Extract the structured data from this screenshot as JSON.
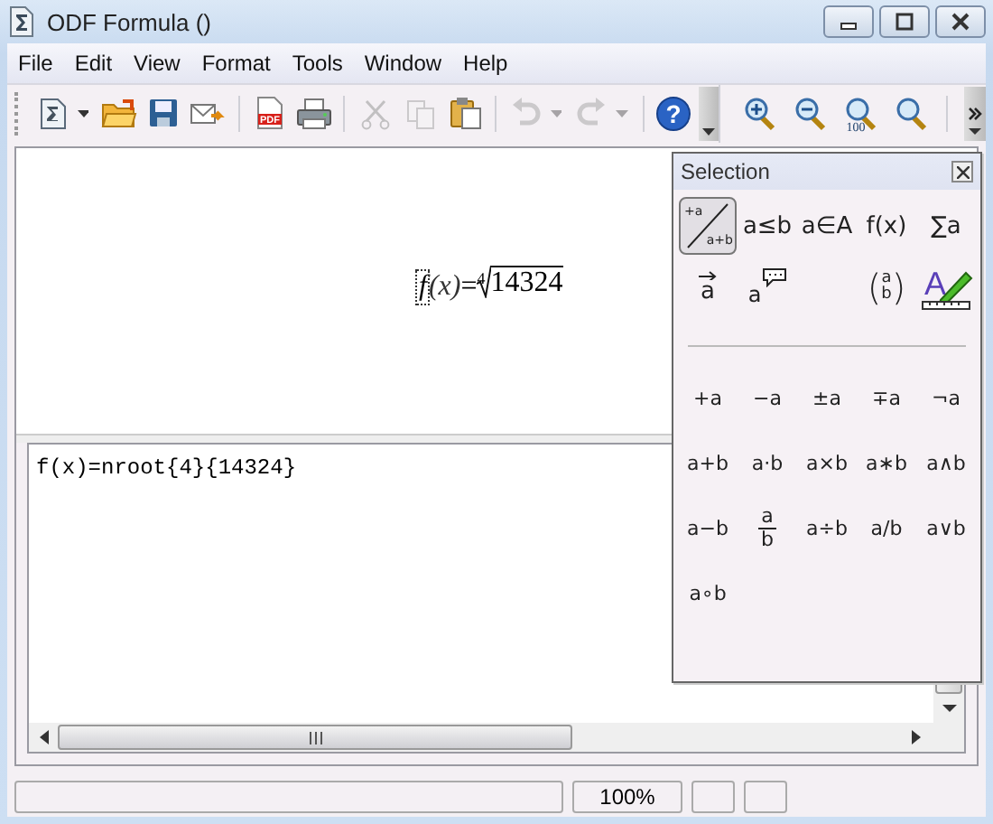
{
  "window": {
    "title": "ODF Formula ()"
  },
  "menu": [
    {
      "label": "File"
    },
    {
      "label": "Edit"
    },
    {
      "label": "View"
    },
    {
      "label": "Format"
    },
    {
      "label": "Tools"
    },
    {
      "label": "Window"
    },
    {
      "label": "Help"
    }
  ],
  "toolbar": [
    {
      "kind": "new",
      "disabled": false,
      "dropdown": true
    },
    {
      "kind": "open",
      "disabled": false
    },
    {
      "kind": "save",
      "disabled": false
    },
    {
      "kind": "mail",
      "disabled": false
    },
    {
      "kind": "sep"
    },
    {
      "kind": "pdf",
      "disabled": false,
      "text": "PDF"
    },
    {
      "kind": "print",
      "disabled": false
    },
    {
      "kind": "sep"
    },
    {
      "kind": "cut",
      "disabled": true
    },
    {
      "kind": "copy",
      "disabled": true
    },
    {
      "kind": "paste",
      "disabled": false
    },
    {
      "kind": "sep"
    },
    {
      "kind": "undo",
      "disabled": true,
      "dropdown": true
    },
    {
      "kind": "redo",
      "disabled": true,
      "dropdown": true
    },
    {
      "kind": "sep"
    },
    {
      "kind": "help",
      "disabled": false,
      "text": "?"
    }
  ],
  "zoom_toolbar": [
    {
      "kind": "zoom-in",
      "disabled": false
    },
    {
      "kind": "zoom-out",
      "disabled": false
    },
    {
      "kind": "zoom-100",
      "disabled": false,
      "text": "100"
    },
    {
      "kind": "zoom-all",
      "disabled": false
    },
    {
      "kind": "sep"
    }
  ],
  "formula": {
    "function": "f",
    "argument": "(x)",
    "equals": "=",
    "index": "4",
    "radicand": "14324"
  },
  "editor": {
    "value": "f(x)=nroot{4}{14324}"
  },
  "selection": {
    "title": "Selection",
    "categories": [
      {
        "kind": "fraction",
        "top": "+a",
        "bottom": "a+b",
        "selected": true
      },
      {
        "kind": "text",
        "label": "a≤b",
        "selected": false
      },
      {
        "kind": "text",
        "label": "a∈A",
        "selected": false
      },
      {
        "kind": "text",
        "label": "f(x)",
        "selected": false
      },
      {
        "kind": "text",
        "label": "∑a",
        "selected": false
      },
      {
        "kind": "vector",
        "label": "a",
        "selected": false
      },
      {
        "kind": "attribute",
        "label": "a",
        "selected": false
      },
      {
        "kind": "empty"
      },
      {
        "kind": "binom",
        "left": "(",
        "top": "a",
        "bottom": "b",
        "right": ")",
        "selected": false
      },
      {
        "kind": "format",
        "label": "A",
        "selected": false
      }
    ],
    "symbols": [
      {
        "kind": "text",
        "label": "+a"
      },
      {
        "kind": "text",
        "label": "−a"
      },
      {
        "kind": "text",
        "label": "±a"
      },
      {
        "kind": "text",
        "label": "∓a"
      },
      {
        "kind": "text",
        "label": "¬a"
      },
      {
        "kind": "text",
        "label": "a+b"
      },
      {
        "kind": "text",
        "label": "a·b"
      },
      {
        "kind": "text",
        "label": "a×b"
      },
      {
        "kind": "text",
        "label": "a∗b"
      },
      {
        "kind": "text",
        "label": "a∧b"
      },
      {
        "kind": "text",
        "label": "a−b"
      },
      {
        "kind": "fraction",
        "top": "a",
        "bottom": "b"
      },
      {
        "kind": "text",
        "label": "a÷b"
      },
      {
        "kind": "text",
        "label": "a/b"
      },
      {
        "kind": "text",
        "label": "a∨b"
      },
      {
        "kind": "text",
        "label": "a∘b"
      }
    ]
  },
  "status_bar": {
    "zoom": "100%"
  }
}
